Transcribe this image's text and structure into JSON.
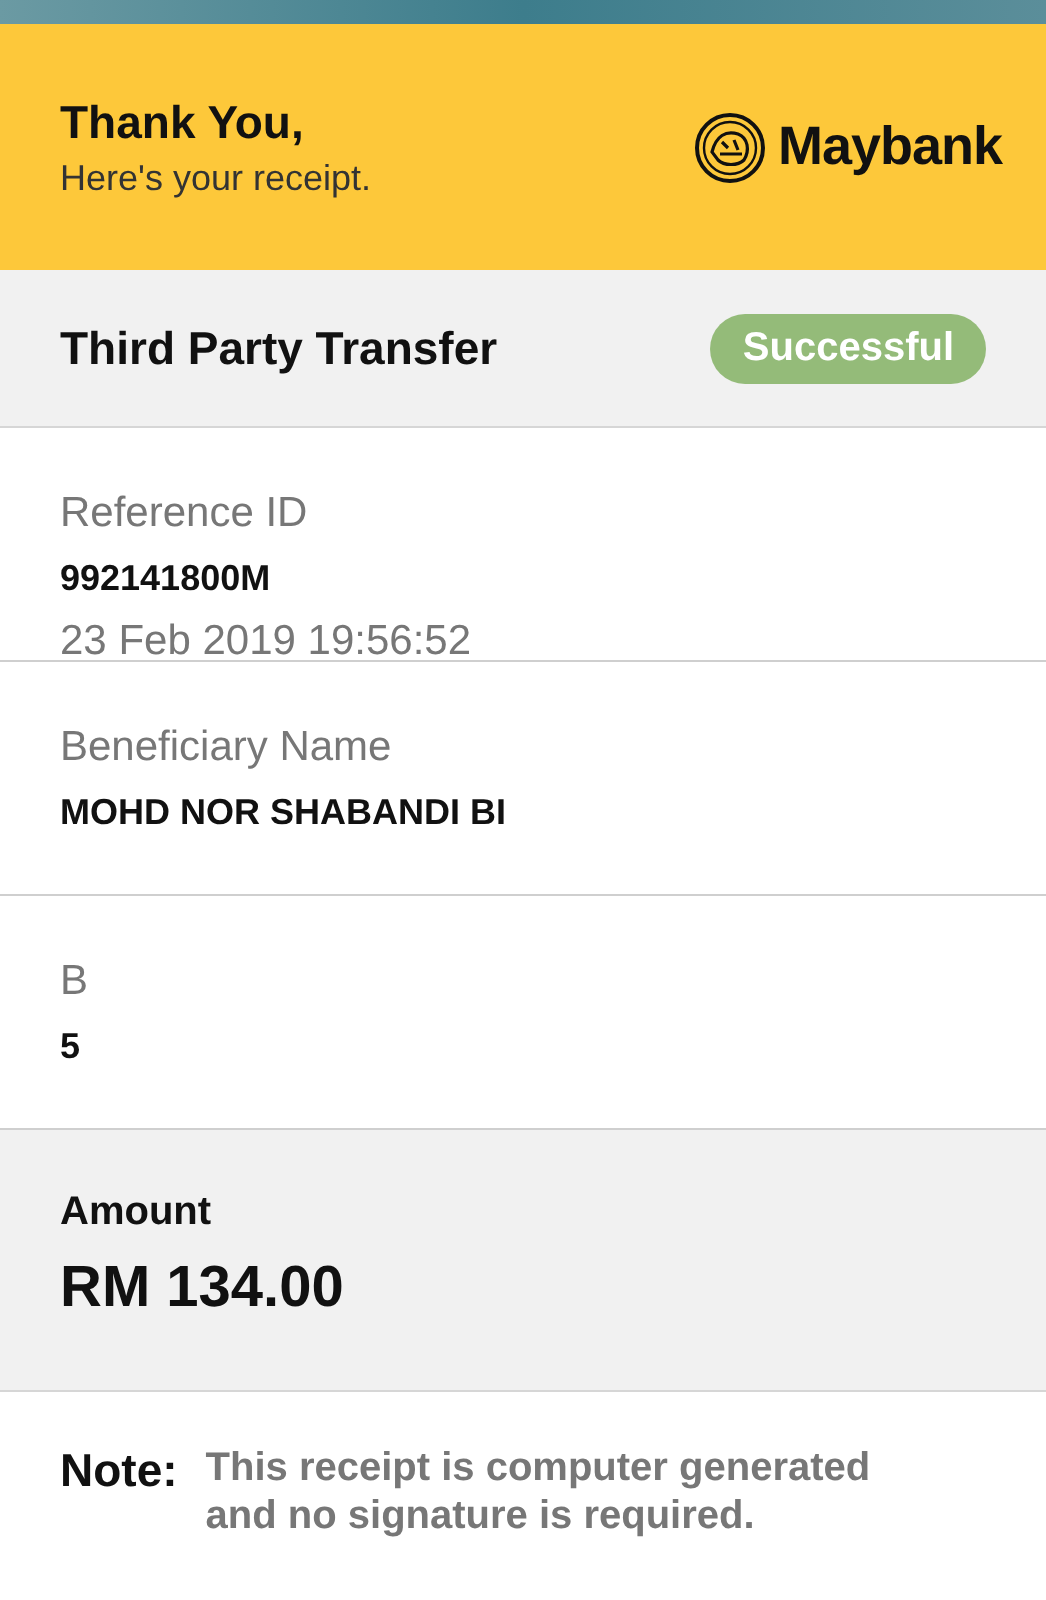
{
  "header": {
    "title": "Thank You,",
    "subtitle": "Here's your receipt.",
    "brand": "Maybank"
  },
  "transaction": {
    "type": "Third Party Transfer",
    "status": "Successful"
  },
  "sections": [
    {
      "label": "Reference ID",
      "value": "992141800M",
      "detail": "23 Feb 2019 19:56:52"
    },
    {
      "label": "Beneficiary Name",
      "value": "MOHD NOR SHABANDI BI"
    },
    {
      "label": "B",
      "value": "5"
    }
  ],
  "amount": {
    "label": "Amount",
    "value": "RM 134.00"
  },
  "note": {
    "label": "Note:",
    "text": "This receipt is computer generated and no signature is required."
  }
}
